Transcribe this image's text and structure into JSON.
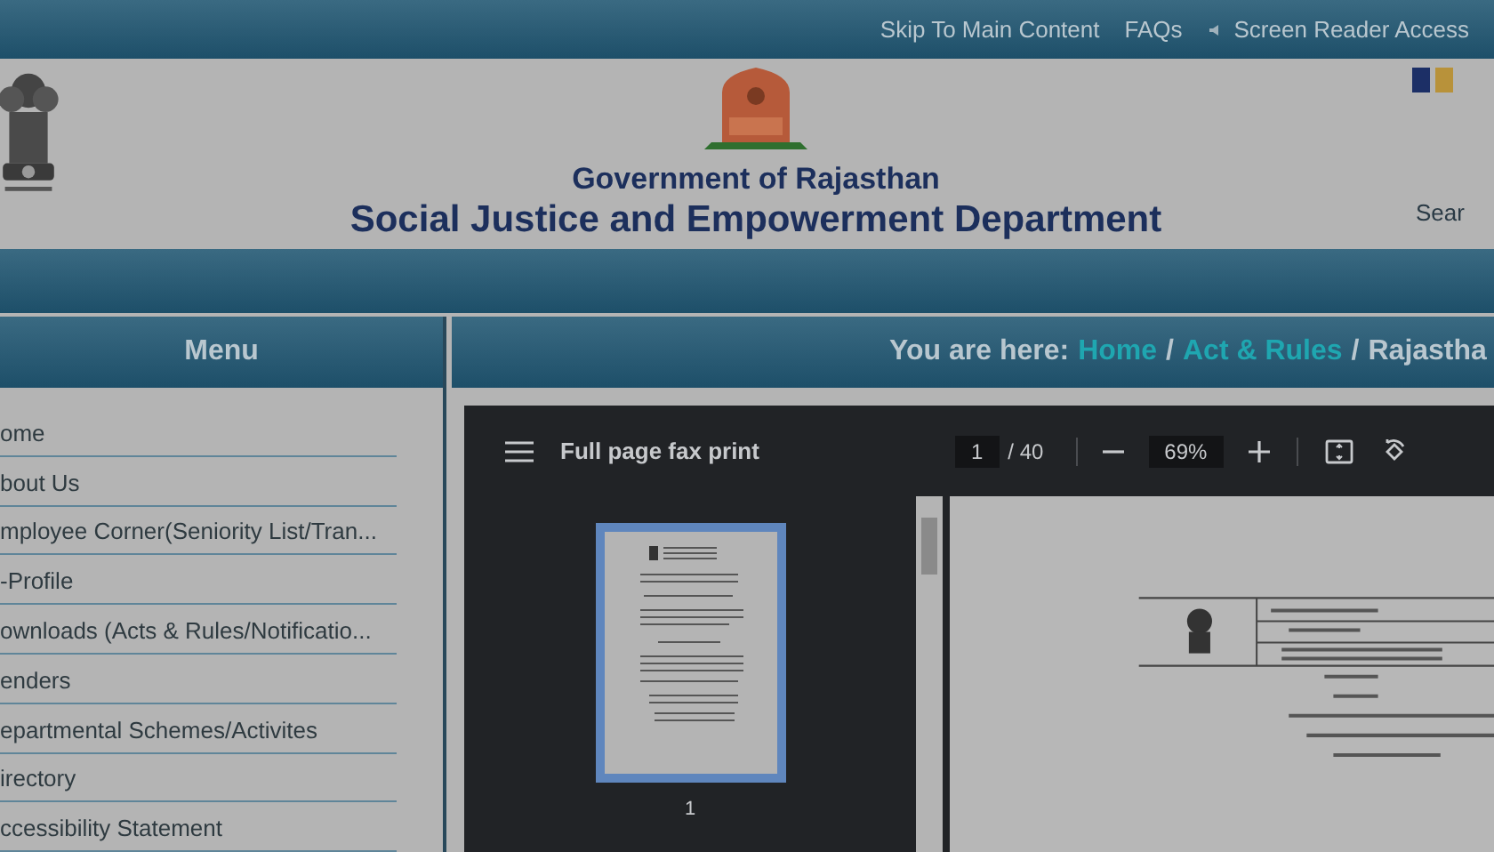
{
  "top_links": [
    {
      "label": "Skip To Main Content",
      "kind": "link"
    },
    {
      "label": "FAQs",
      "kind": "link"
    },
    {
      "label": "Screen Reader Access",
      "kind": "screen_reader"
    }
  ],
  "header": {
    "government": "Government of Rajasthan",
    "department": "Social Justice and Empowerment Department",
    "search_label": "Sear"
  },
  "menu": {
    "title": "Menu",
    "items": [
      "ome",
      "bout Us",
      "mployee Corner(Seniority List/Tran...",
      "-Profile",
      "ownloads (Acts & Rules/Notificatio...",
      "enders",
      "epartmental Schemes/Activites",
      "irectory",
      "ccessibility Statement"
    ]
  },
  "breadcrumb": {
    "prefix": "You are here:",
    "separator": "/",
    "crumbs": [
      {
        "label": "Home",
        "kind": "link"
      },
      {
        "label": "Act & Rules",
        "kind": "link"
      },
      {
        "label": "Rajastha",
        "kind": "current"
      }
    ]
  },
  "viewer": {
    "document_title": "Full page fax print",
    "page": "1",
    "page_total": "/ 40",
    "zoom": "69%",
    "thumbnails": [
      {
        "label": "1",
        "selected": true
      }
    ]
  }
}
